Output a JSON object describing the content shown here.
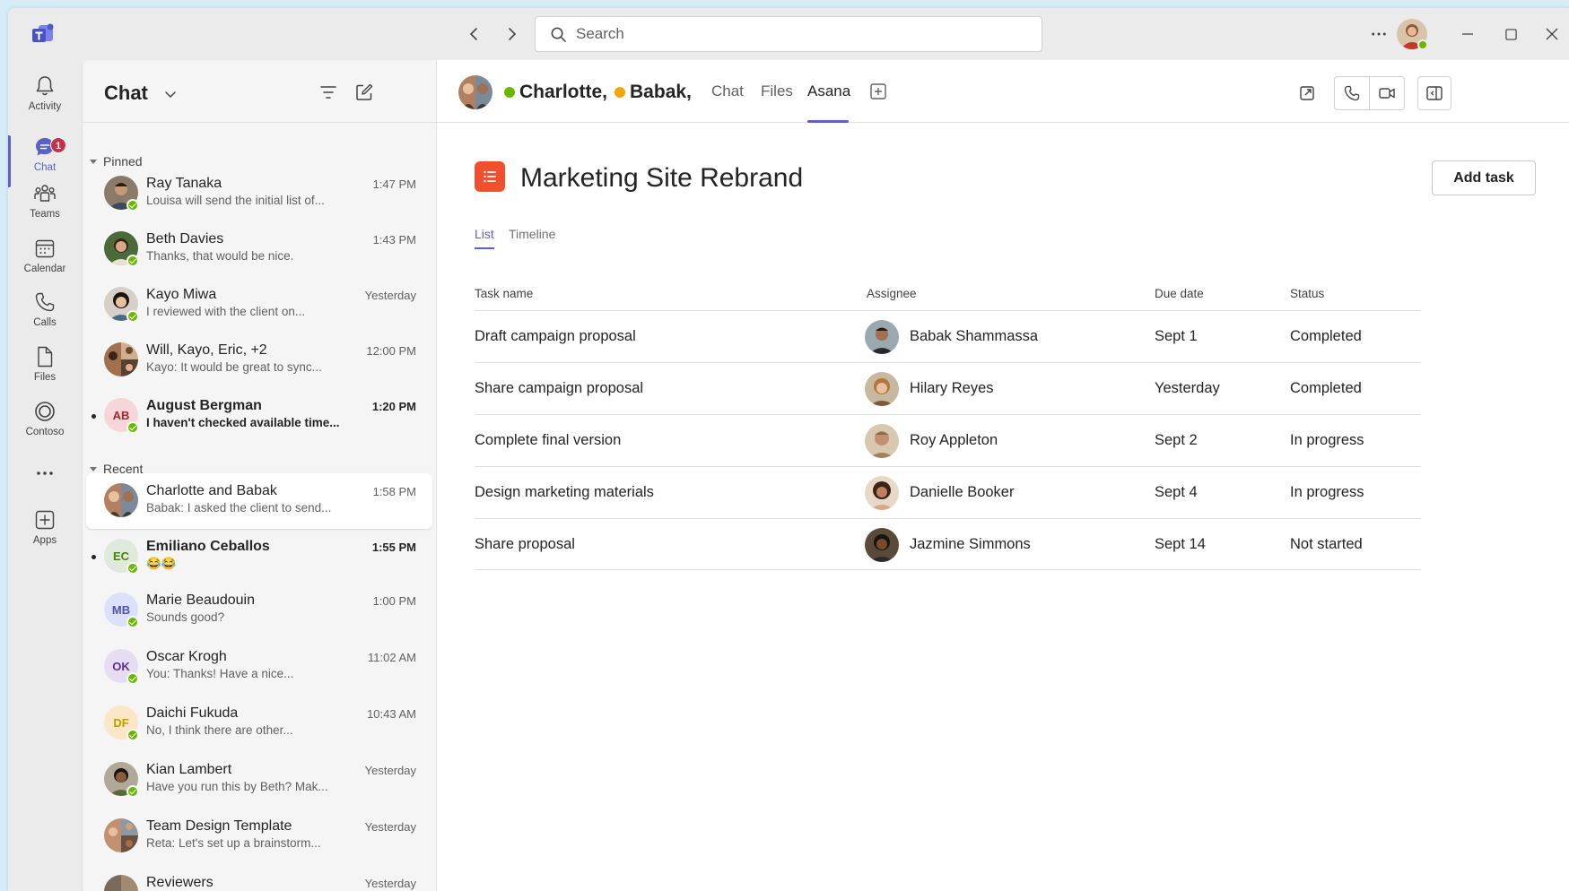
{
  "titlebar": {
    "search_placeholder": "Search",
    "more_label": "..."
  },
  "rail": {
    "items": [
      {
        "label": "Activity",
        "icon": "bell-icon"
      },
      {
        "label": "Chat",
        "icon": "chat-icon",
        "badge": "1"
      },
      {
        "label": "Teams",
        "icon": "teams-icon"
      },
      {
        "label": "Calendar",
        "icon": "calendar-icon"
      },
      {
        "label": "Calls",
        "icon": "phone-icon"
      },
      {
        "label": "Files",
        "icon": "file-icon"
      },
      {
        "label": "Contoso",
        "icon": "contoso-icon"
      },
      {
        "label": "...",
        "icon": "more-icon"
      },
      {
        "label": "Apps",
        "icon": "apps-icon"
      }
    ],
    "accent": "#5b5fc7"
  },
  "chatlist": {
    "title": "Chat",
    "sections": {
      "pinned": "Pinned",
      "recent": "Recent"
    },
    "items": [
      {
        "name": "Ray Tanaka",
        "time": "1:47 PM",
        "preview": "Louisa will send the initial list of..."
      },
      {
        "name": "Beth Davies",
        "time": "1:43 PM",
        "preview": "Thanks, that would be nice."
      },
      {
        "name": "Kayo Miwa",
        "time": "Yesterday",
        "preview": "I reviewed with the client on..."
      },
      {
        "name": "Will, Kayo, Eric, +2",
        "time": "12:00 PM",
        "preview": "Kayo: It would be great to sync..."
      },
      {
        "name": "August Bergman",
        "time": "1:20 PM",
        "preview": "I haven't checked available time...",
        "initials": "AB"
      },
      {
        "name": "Charlotte and Babak",
        "time": "1:58 PM",
        "preview": "Babak: I asked the client to send..."
      },
      {
        "name": "Emiliano Ceballos",
        "time": "1:55 PM",
        "preview": "😂😂",
        "initials": "EC"
      },
      {
        "name": "Marie Beaudouin",
        "time": "1:00 PM",
        "preview": "Sounds good?",
        "initials": "MB"
      },
      {
        "name": "Oscar Krogh",
        "time": "11:02 AM",
        "preview": "You: Thanks! Have a nice...",
        "initials": "OK"
      },
      {
        "name": "Daichi Fukuda",
        "time": "10:43 AM",
        "preview": "No, I think there are other...",
        "initials": "DF"
      },
      {
        "name": "Kian Lambert",
        "time": "Yesterday",
        "preview": "Have you run this by Beth? Mak..."
      },
      {
        "name": "Team Design Template",
        "time": "Yesterday",
        "preview": "Reta: Let's set up a brainstorm..."
      },
      {
        "name": "Reviewers",
        "time": "Yesterday",
        "preview": ""
      }
    ]
  },
  "main": {
    "participants": [
      "Charlotte,",
      "Babak,"
    ],
    "tabs": [
      "Chat",
      "Files",
      "Asana"
    ],
    "active_tab": "Asana",
    "app": {
      "title": "Marketing Site Rebrand",
      "add_task": "Add task",
      "views": [
        "List",
        "Timeline"
      ],
      "columns": [
        "Task name",
        "Assignee",
        "Due date",
        "Status"
      ],
      "rows": [
        {
          "task": "Draft campaign proposal",
          "assignee": "Babak Shammassa",
          "due": "Sept 1",
          "status": "Completed"
        },
        {
          "task": "Share campaign proposal",
          "assignee": "Hilary Reyes",
          "due": "Yesterday",
          "status": "Completed"
        },
        {
          "task": "Complete final version",
          "assignee": "Roy Appleton",
          "due": "Sept 2",
          "status": "In progress"
        },
        {
          "task": "Design marketing materials",
          "assignee": "Danielle Booker",
          "due": "Sept 4",
          "status": "In progress"
        },
        {
          "task": "Share proposal",
          "assignee": "Jazmine Simmons",
          "due": "Sept 14",
          "status": "Not started"
        }
      ],
      "brand_color": "#f0502e"
    }
  }
}
